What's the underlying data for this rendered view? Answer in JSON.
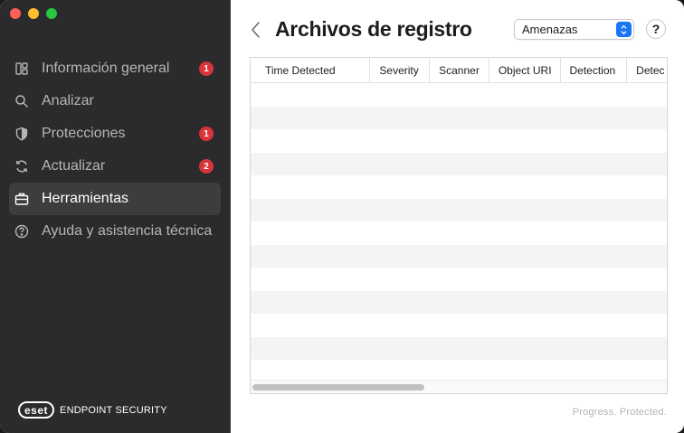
{
  "sidebar": {
    "items": [
      {
        "label": "Información general",
        "icon": "dashboard-icon",
        "badge": "1"
      },
      {
        "label": "Analizar",
        "icon": "search-icon",
        "badge": ""
      },
      {
        "label": "Protecciones",
        "icon": "shield-icon",
        "badge": "1"
      },
      {
        "label": "Actualizar",
        "icon": "refresh-icon",
        "badge": "2"
      },
      {
        "label": "Herramientas",
        "icon": "briefcase-icon",
        "badge": ""
      },
      {
        "label": "Ayuda y asistencia técnica",
        "icon": "help-circle-icon",
        "badge": ""
      }
    ],
    "active_index": 4,
    "brand": {
      "logo": "eset",
      "product": "ENDPOINT SECURITY"
    }
  },
  "header": {
    "title": "Archivos de registro",
    "filter_value": "Amenazas",
    "help_label": "?"
  },
  "table": {
    "columns": [
      "Time Detected",
      "Severity",
      "Scanner",
      "Object URI",
      "Detection",
      "Detec"
    ],
    "rows": []
  },
  "footer": {
    "slogan": "Progress. Protected."
  },
  "colors": {
    "sidebar_bg": "#2b2a2c",
    "badge": "#d9343a",
    "accent": "#1976f5"
  }
}
